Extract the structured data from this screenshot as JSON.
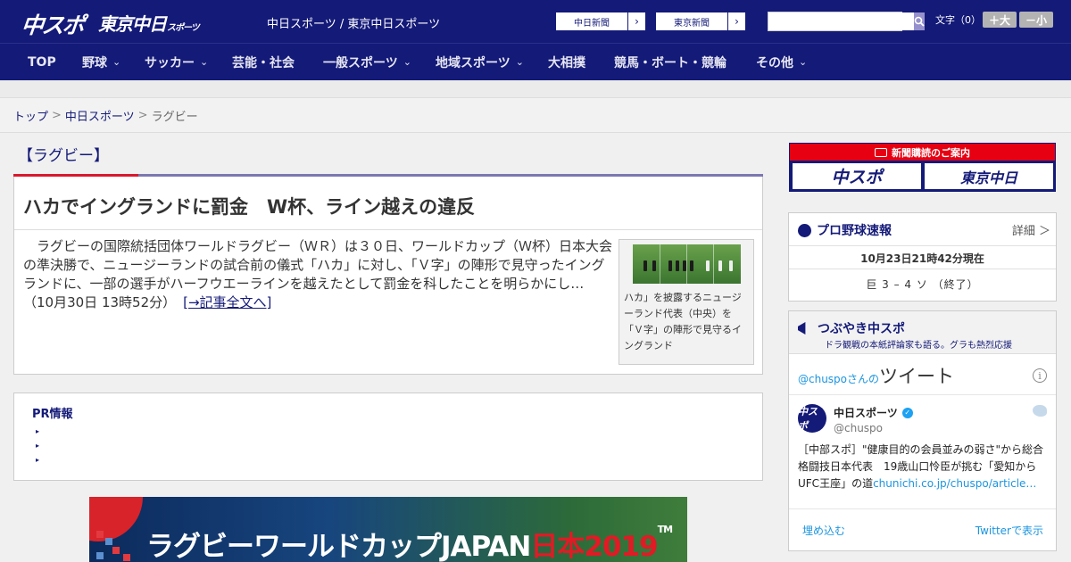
{
  "header": {
    "logo_chuspo": "中スポ",
    "logo_tokyo": "東京中日",
    "logo_tokyo_sub": "スポーツ",
    "site_title": "中日スポーツ / 東京中日スポーツ",
    "ext_links": [
      {
        "label": "中日新聞",
        "arrow": "›"
      },
      {
        "label": "東京新聞",
        "arrow": "›"
      }
    ],
    "search": {
      "value": "",
      "placeholder": "",
      "icon": "search-icon"
    },
    "font_size": {
      "label": "文字（0）",
      "increase": "＋大",
      "decrease": "－小"
    }
  },
  "nav": {
    "items": [
      {
        "label": "TOP",
        "has_submenu": false
      },
      {
        "label": "野球",
        "has_submenu": true
      },
      {
        "label": "サッカー",
        "has_submenu": true
      },
      {
        "label": "芸能・社会",
        "has_submenu": false
      },
      {
        "label": "一般スポーツ",
        "has_submenu": true
      },
      {
        "label": "地域スポーツ",
        "has_submenu": true
      },
      {
        "label": "大相撲",
        "has_submenu": false
      },
      {
        "label": "競馬・ボート・競輪",
        "has_submenu": false
      },
      {
        "label": "その他",
        "has_submenu": true
      }
    ],
    "chevron": "⌄"
  },
  "breadcrumb": {
    "items": [
      "トップ",
      "中日スポーツ",
      "ラグビー"
    ],
    "separator": ">"
  },
  "main": {
    "category": "【ラグビー】",
    "article": {
      "title": "ハカでイングランドに罰金　W杯、ライン越えの違反",
      "body": "　ラグビーの国際統括団体ワールドラグビー（ＷＲ）は３０日、ワールドカップ（Ｗ杯）日本大会の準決勝で、ニュージーランドの試合前の儀式「ハカ」に対し、「Ｖ字」の陣形で見守ったイングランドに、一部の選手がハーフウエーラインを越えたとして罰金を科したことを明らかにし…（10月30日 13時52分）",
      "more_link": "[→記事全文へ]",
      "photo_caption": "ハカ」を披露するニュージーランド代表（中央）を「Ｖ字」の陣形で見守るイングランド"
    },
    "pr": {
      "title": "PR情報",
      "bullet": "▸"
    },
    "banner": {
      "text": "ラグビーワールドカップJAPAN",
      "red_text": "日本2019",
      "tm": "TM"
    }
  },
  "sidebar": {
    "subscription": {
      "heading": "新聞購読のご案内",
      "buttons": [
        "中スポ",
        "東京中日"
      ]
    },
    "baseball": {
      "title": "プロ野球速報",
      "detail": "詳細 ＞",
      "time": "10月23日21時42分現在",
      "score": "巨 3 – 4 ソ （終了）"
    },
    "tweets": {
      "title": "つぶやき中スポ",
      "subtitle": "ドラ観戦の本紙評論家も語る。グラも熱烈応援",
      "handle": "@chuspoさんの",
      "handle_big": "ツイート",
      "info": "i",
      "avatar": "中スポ",
      "name": "中日スポーツ",
      "account": "@chuspo",
      "tweet_text": "［中部スポ］\"健康目的の会員並みの弱さ\"から総合格闘技日本代表　19歳山口怜臣が挑む「愛知からUFC王座」の道",
      "tweet_link": "chunichi.co.jp/chuspo/article…",
      "embed": "埋め込む",
      "view_on_twitter": "Twitterで表示"
    }
  },
  "colors": {
    "brand_navy": "#141a78",
    "accent_red": "#d9182d",
    "link_blue": "#1b95e0"
  }
}
